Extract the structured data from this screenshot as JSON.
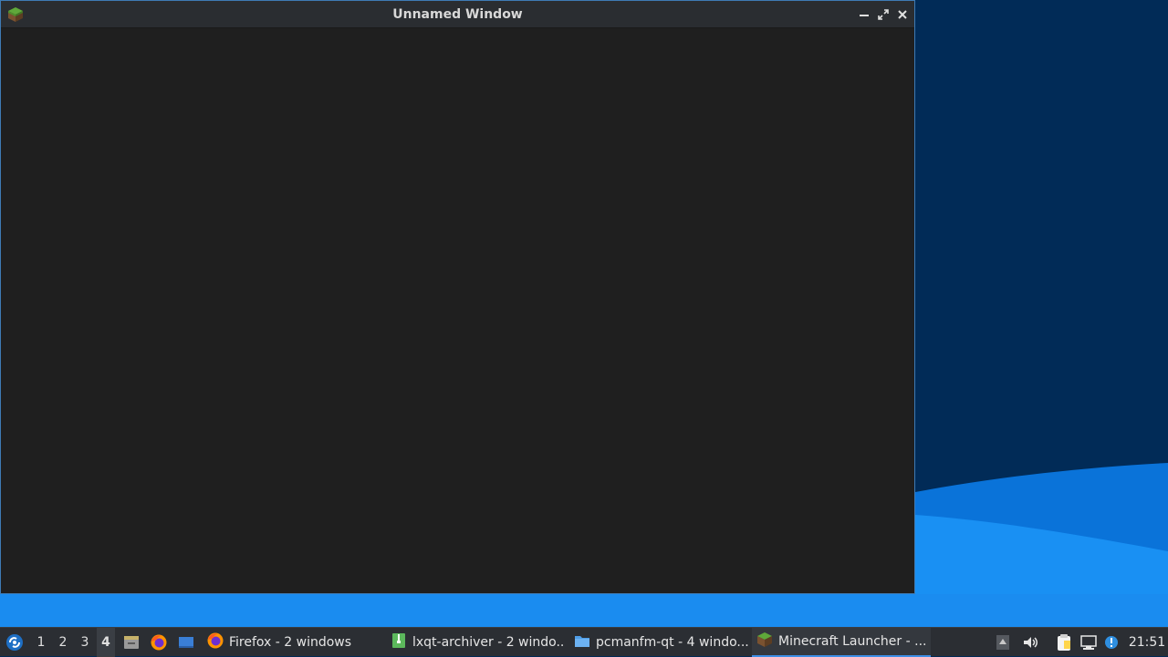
{
  "window": {
    "title": "Unnamed Window",
    "icon": "minecraft-grass-block-icon",
    "controls": [
      "minimize",
      "maximize",
      "close"
    ]
  },
  "taskbar": {
    "start_icon": "lxqt-start-icon",
    "desktops": [
      "1",
      "2",
      "3",
      "4"
    ],
    "active_desktop": "4",
    "quicklaunch": [
      "file-manager-icon",
      "firefox-icon",
      "show-desktop-icon"
    ],
    "tasks": [
      {
        "label": "Firefox - 2 windows",
        "icon": "firefox-icon"
      },
      {
        "label": "lxqt-archiver - 2 windo...",
        "icon": "archive-icon"
      },
      {
        "label": "pcmanfm-qt - 4 windo...",
        "icon": "folder-icon"
      },
      {
        "label": "Minecraft Launcher - ...",
        "icon": "minecraft-grass-block-icon",
        "active": true
      }
    ],
    "tray": [
      "show-hidden-icons",
      "volume-icon",
      "clipboard-icon",
      "network-icon",
      "notification-icon"
    ],
    "clock": "21:51"
  },
  "colors": {
    "wallpaper_dark": "#012b57",
    "wallpaper_light": "#1a8cf0",
    "window_bg": "#1f1f1f",
    "titlebar_bg": "#2a2d31",
    "taskbar_bg": "#2b2e33",
    "accent": "#3d8ee6"
  }
}
